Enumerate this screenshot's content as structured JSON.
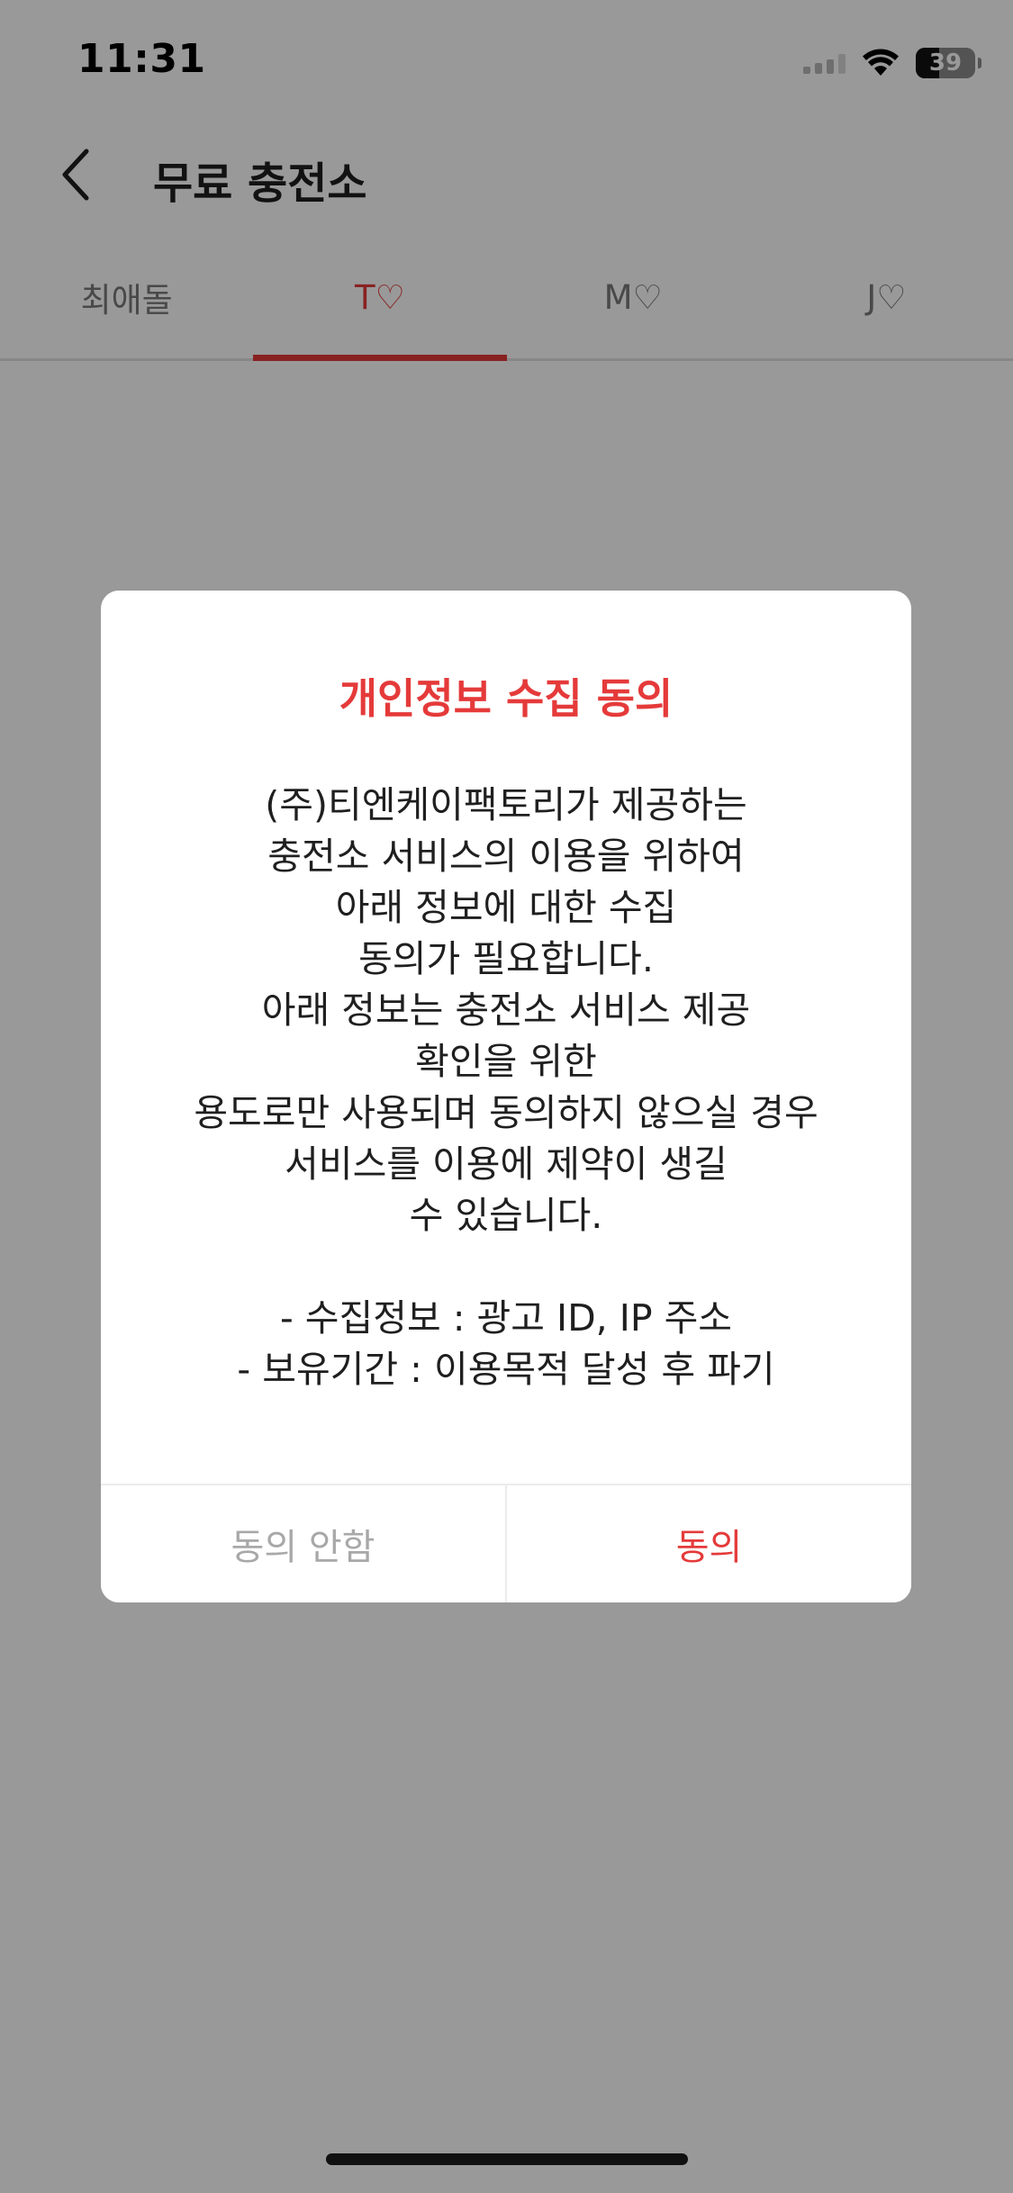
{
  "status_bar": {
    "time": "11:31",
    "battery": "39",
    "battery_level": 0.39
  },
  "header": {
    "title": "무료 충전소"
  },
  "tabs": [
    {
      "label": "최애돌",
      "active": false
    },
    {
      "label": "T♡",
      "active": true
    },
    {
      "label": "M♡",
      "active": false
    },
    {
      "label": "J♡",
      "active": false
    }
  ],
  "dialog": {
    "title": "개인정보 수집 동의",
    "lines": [
      "(주)티엔케이팩토리가 제공하는",
      "충전소 서비스의 이용을 위하여",
      "아래 정보에 대한 수집",
      "동의가 필요합니다.",
      "아래 정보는 충전소 서비스 제공",
      "확인을 위한",
      "용도로만 사용되며 동의하지 않으실 경우",
      "서비스를 이용에 제약이 생길",
      "수 있습니다."
    ],
    "info_lines": [
      "- 수집정보 : 광고 ID, IP 주소",
      "- 보유기간 : 이용목적 달성 후 파기"
    ],
    "disagree_label": "동의 안함",
    "agree_label": "동의"
  },
  "colors": {
    "accent": "#e53a3a",
    "muted_text": "#a8a8a8",
    "overlay": "rgba(0,0,0,0.4)"
  }
}
